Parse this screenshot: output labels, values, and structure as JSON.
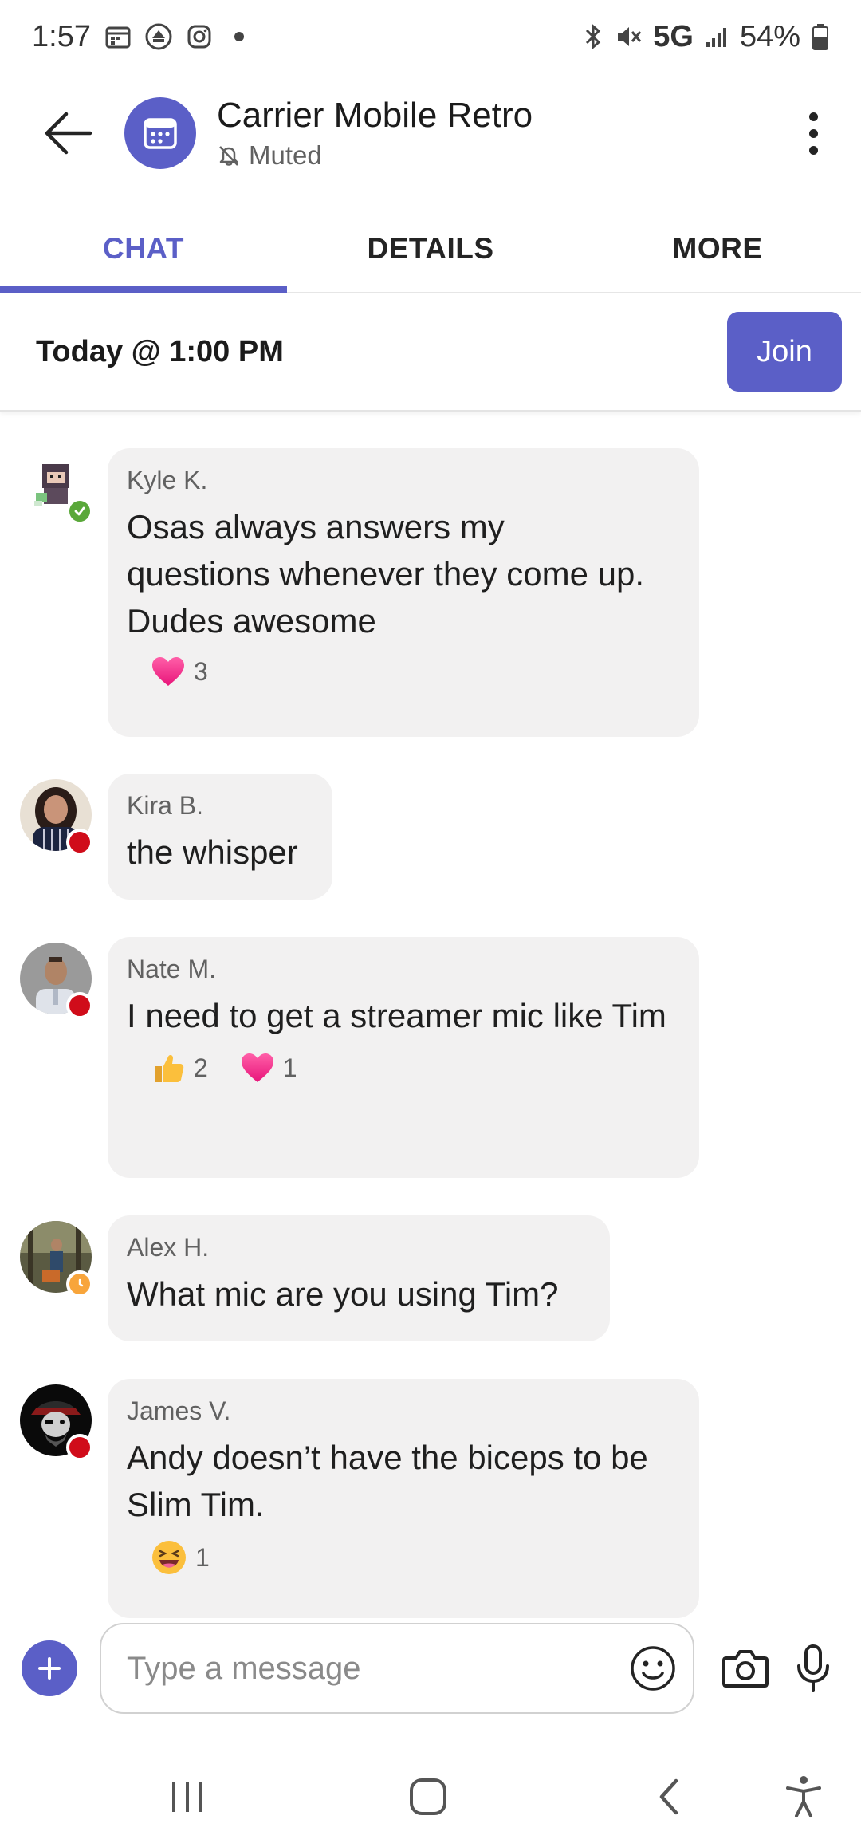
{
  "status_bar": {
    "time": "1:57",
    "network": "5G",
    "battery": "54%"
  },
  "header": {
    "title": "Carrier Mobile Retro",
    "subtitle": "Muted",
    "accent_color": "#5b5fc7"
  },
  "tabs": [
    {
      "label": "CHAT",
      "active": true
    },
    {
      "label": "DETAILS",
      "active": false
    },
    {
      "label": "MORE",
      "active": false
    }
  ],
  "meeting": {
    "time": "Today @ 1:00 PM",
    "join_label": "Join"
  },
  "messages": [
    {
      "sender": "Kyle K.",
      "text": "Osas always answers my questions whenever they come up. Dudes awesome",
      "presence": "available",
      "reactions": [
        {
          "emoji": "heart",
          "count": "3"
        }
      ]
    },
    {
      "sender": "Kira B.",
      "text": "the whisper",
      "presence": "busy",
      "reactions": []
    },
    {
      "sender": "Nate M.",
      "text": "I need to get a streamer mic like Tim",
      "presence": "busy",
      "reactions": [
        {
          "emoji": "thumbs-up",
          "count": "2"
        },
        {
          "emoji": "heart",
          "count": "1"
        }
      ]
    },
    {
      "sender": "Alex H.",
      "text": "What mic are you using Tim?",
      "presence": "away",
      "reactions": []
    },
    {
      "sender": "James V.",
      "text": "Andy doesn’t have the biceps to be Slim Tim.",
      "presence": "busy",
      "reactions": [
        {
          "emoji": "laughing",
          "count": "1"
        }
      ]
    }
  ],
  "compose": {
    "placeholder": "Type a message"
  }
}
